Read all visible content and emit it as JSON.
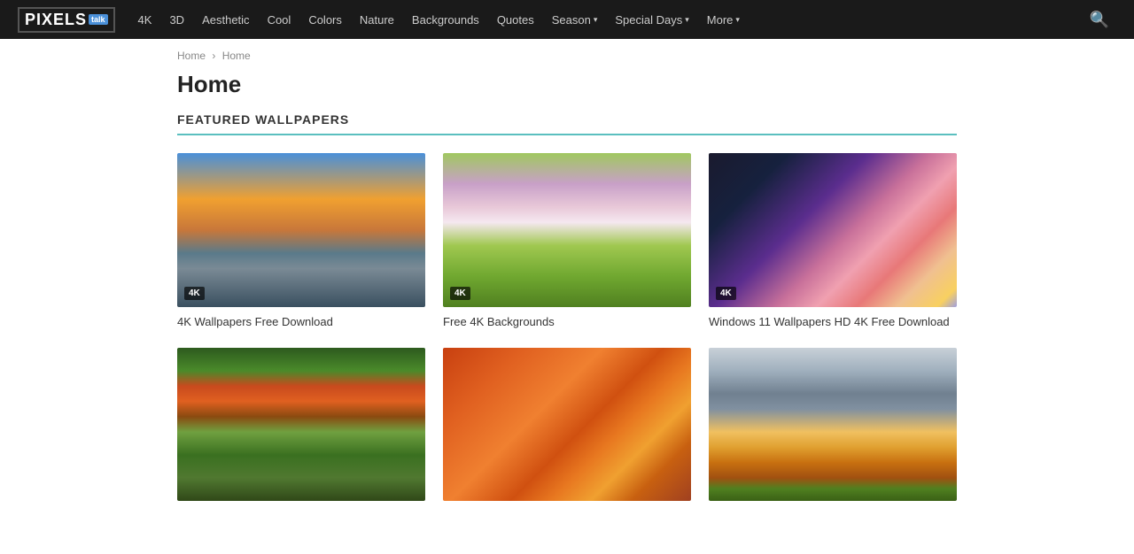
{
  "nav": {
    "logo": {
      "pixels": "PIXELS",
      "talk": "talk"
    },
    "items": [
      {
        "label": "4K",
        "has_dropdown": false
      },
      {
        "label": "3D",
        "has_dropdown": false
      },
      {
        "label": "Aesthetic",
        "has_dropdown": false
      },
      {
        "label": "Cool",
        "has_dropdown": false
      },
      {
        "label": "Colors",
        "has_dropdown": false
      },
      {
        "label": "Nature",
        "has_dropdown": false
      },
      {
        "label": "Backgrounds",
        "has_dropdown": false
      },
      {
        "label": "Quotes",
        "has_dropdown": false
      },
      {
        "label": "Season",
        "has_dropdown": true
      },
      {
        "label": "Special Days",
        "has_dropdown": true
      },
      {
        "label": "More",
        "has_dropdown": true
      }
    ]
  },
  "breadcrumb": {
    "items": [
      "Home",
      "Home"
    ]
  },
  "page_title": "Home",
  "section_header": "FEATURED WALLPAPERS",
  "wallpapers_row1": [
    {
      "id": "sunset",
      "label": "4K Wallpapers Free Download",
      "badge": "4K",
      "img_class": "img-sunset"
    },
    {
      "id": "cherry",
      "label": "Free 4K Backgrounds",
      "badge": "4K",
      "img_class": "img-cherry"
    },
    {
      "id": "windows11",
      "label": "Windows 11 Wallpapers HD 4K Free Download",
      "badge": "4K",
      "img_class": "img-windows11"
    }
  ],
  "wallpapers_row2": [
    {
      "id": "forest-waterfall",
      "label": "",
      "badge": "",
      "img_class": "img-forest-waterfall"
    },
    {
      "id": "autumn-leaves",
      "label": "",
      "badge": "",
      "img_class": "img-autumn-leaves"
    },
    {
      "id": "mountain-autumn",
      "label": "",
      "badge": "",
      "img_class": "img-mountain-autumn"
    }
  ]
}
